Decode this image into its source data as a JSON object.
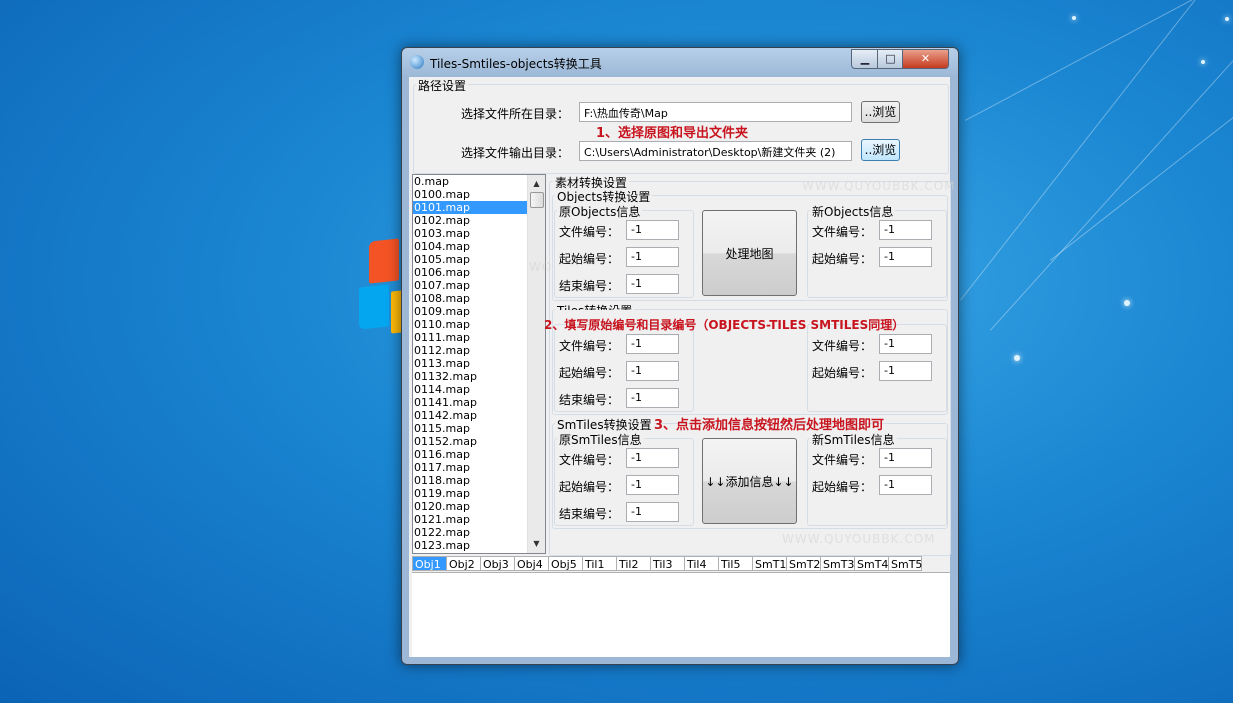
{
  "window": {
    "title": "Tiles-Smtiles-objects转换工具",
    "minimize_label": "▁",
    "maximize_label": "□",
    "close_label": "✕"
  },
  "path_settings": {
    "group_title": "路径设置",
    "source_label": "选择文件所在目录：",
    "source_value": "F:\\热血传奇\\Map",
    "output_label": "选择文件输出目录：",
    "output_value": "C:\\Users\\Administrator\\Desktop\\新建文件夹 (2)",
    "browse_label": "..浏览"
  },
  "annotations": {
    "step1": "1、选择原图和导出文件夹",
    "step2": "2、填写原始编号和目录编号（OBJECTS-TILES SMTILES同理）",
    "step3": "3、点击添加信息按钮然后处理地图即可"
  },
  "watermarks": [
    "WWW.QUYOUBBK.COM",
    "WWW.QUYOUBBK.COM",
    "WO"
  ],
  "file_list": {
    "items": [
      "0.map",
      "0100.map",
      "0101.map",
      "0102.map",
      "0103.map",
      "0104.map",
      "0105.map",
      "0106.map",
      "0107.map",
      "0108.map",
      "0109.map",
      "0110.map",
      "0111.map",
      "0112.map",
      "0113.map",
      "01132.map",
      "0114.map",
      "01141.map",
      "01142.map",
      "0115.map",
      "01152.map",
      "0116.map",
      "0117.map",
      "0118.map",
      "0119.map",
      "0120.map",
      "0121.map",
      "0122.map",
      "0123.map"
    ],
    "selected_index": 2,
    "scroll_up": "▲",
    "scroll_down": "▼"
  },
  "material": {
    "group_title": "素材转换设置",
    "file_no_label": "文件编号：",
    "start_no_label": "起始编号：",
    "end_no_label": "结束编号：",
    "objects": {
      "title": "Objects转换设置",
      "orig_title": "原Objects信息",
      "new_title": "新Objects信息",
      "orig_values": [
        "-1",
        "-1",
        "-1"
      ],
      "new_values": [
        "-1",
        "-1"
      ],
      "button_label": "处理地图"
    },
    "tiles": {
      "title": "Tiles转换设置",
      "orig_values": [
        "-1",
        "-1",
        "-1"
      ],
      "new_values": [
        "-1",
        "-1"
      ]
    },
    "smtiles": {
      "title": "SmTiles转换设置",
      "orig_title": "原SmTiles信息",
      "new_title": "新SmTiles信息",
      "orig_values": [
        "-1",
        "-1",
        "-1"
      ],
      "new_values": [
        "-1",
        "-1"
      ],
      "button_label": "↓↓添加信息↓↓"
    }
  },
  "tabs": {
    "labels": [
      "Obj1",
      "Obj2",
      "Obj3",
      "Obj4",
      "Obj5",
      "Til1",
      "Til2",
      "Til3",
      "Til4",
      "Til5",
      "SmT1",
      "SmT2",
      "SmT3",
      "SmT4",
      "SmT5"
    ],
    "active_index": 0
  }
}
